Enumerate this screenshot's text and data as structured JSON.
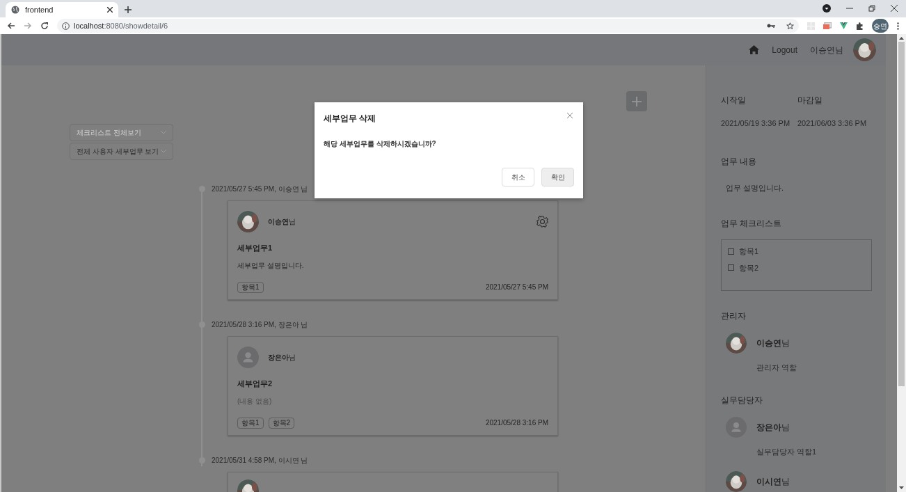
{
  "browser": {
    "tab_title": "frontend",
    "url_host": "localhost",
    "url_rest": ":8080/showdetail/6",
    "profile": "승연"
  },
  "header": {
    "logout": "Logout",
    "user": "이승연님"
  },
  "filters": {
    "checklist_placeholder": "체크리스트 전체보기",
    "user_filter": "전체 사용자 세부업무 보기"
  },
  "timeline": [
    {
      "meta": "2021/05/27 5:45 PM, 이승연 님",
      "author": "**이승연**님",
      "has_photo": true,
      "settings": true,
      "title": "세부업무1",
      "description": "세부업무 설명입니다.",
      "empty": false,
      "tags": [
        "항목1"
      ],
      "date": "2021/05/27 5:45 PM"
    },
    {
      "meta": "2021/05/28 3:16 PM, 장은아 님",
      "author": "**장은아**님",
      "has_photo": false,
      "settings": false,
      "title": "세부업무2",
      "description": "(내용 없음)",
      "empty": true,
      "tags": [
        "항목1",
        "항목2"
      ],
      "date": "2021/05/28 3:16 PM"
    },
    {
      "meta": "2021/05/31 4:58 PM, 이시연 님",
      "has_photo": true
    }
  ],
  "detail": {
    "start_label": "시작일",
    "start": "2021/05/19 3:36 PM",
    "end_label": "마감일",
    "end": "2021/06/03 3:36 PM",
    "content_label": "업무 내용",
    "content": "업무 설명입니다.",
    "checklist_label": "업무 체크리스트",
    "checklist": [
      {
        "label": "항목1",
        "checked": false
      },
      {
        "label": "항목2",
        "checked": false
      }
    ],
    "manager_label": "관리자",
    "managers": [
      {
        "name": "**이승연**님",
        "role": "관리자 역할",
        "has_photo": true
      }
    ],
    "staff_label": "실무담당자",
    "staff": [
      {
        "name": "**장은아**님",
        "role": "실무담당자 역할1",
        "has_photo": false
      },
      {
        "name": "**이시연**님",
        "has_photo": true
      }
    ]
  },
  "dialog": {
    "title": "세부업무 삭제",
    "message": "해당 세부업무를 삭제하시겠습니까?",
    "cancel": "취소",
    "confirm": "확인"
  }
}
